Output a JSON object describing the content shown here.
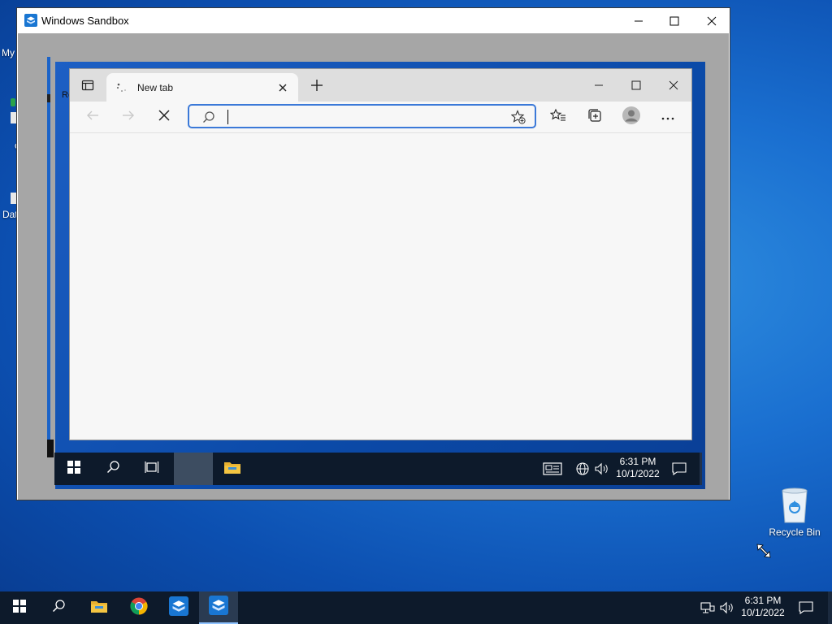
{
  "host": {
    "desktop_peek": {
      "my": "My",
      "re": "Re",
      "dat": "Dat",
      "c": "c"
    },
    "recycle_bin_label": "Recycle Bin",
    "taskbar": {
      "apps": [
        "start-icon",
        "search-icon",
        "file-explorer-icon",
        "chrome-icon",
        "windows-sandbox-icon",
        "windows-sandbox-icon"
      ],
      "time": "6:31 PM",
      "date": "10/1/2022"
    }
  },
  "sandbox_window": {
    "title": "Windows Sandbox",
    "controls": [
      "minimize",
      "maximize",
      "close"
    ]
  },
  "edge": {
    "tab": {
      "label": "New tab"
    },
    "address": {
      "value": "",
      "placeholder": ""
    },
    "toolbar_icons": [
      "back-icon",
      "forward-icon",
      "stop-icon",
      "favorites-icon",
      "collections-icon",
      "profile-icon",
      "more-icon"
    ]
  },
  "guest_taskbar": {
    "time": "6:31 PM",
    "date": "10/1/2022"
  },
  "colors": {
    "accent": "#3b79d8",
    "taskbar": "#0d1a2b",
    "desktop": "#1a6fd0"
  }
}
